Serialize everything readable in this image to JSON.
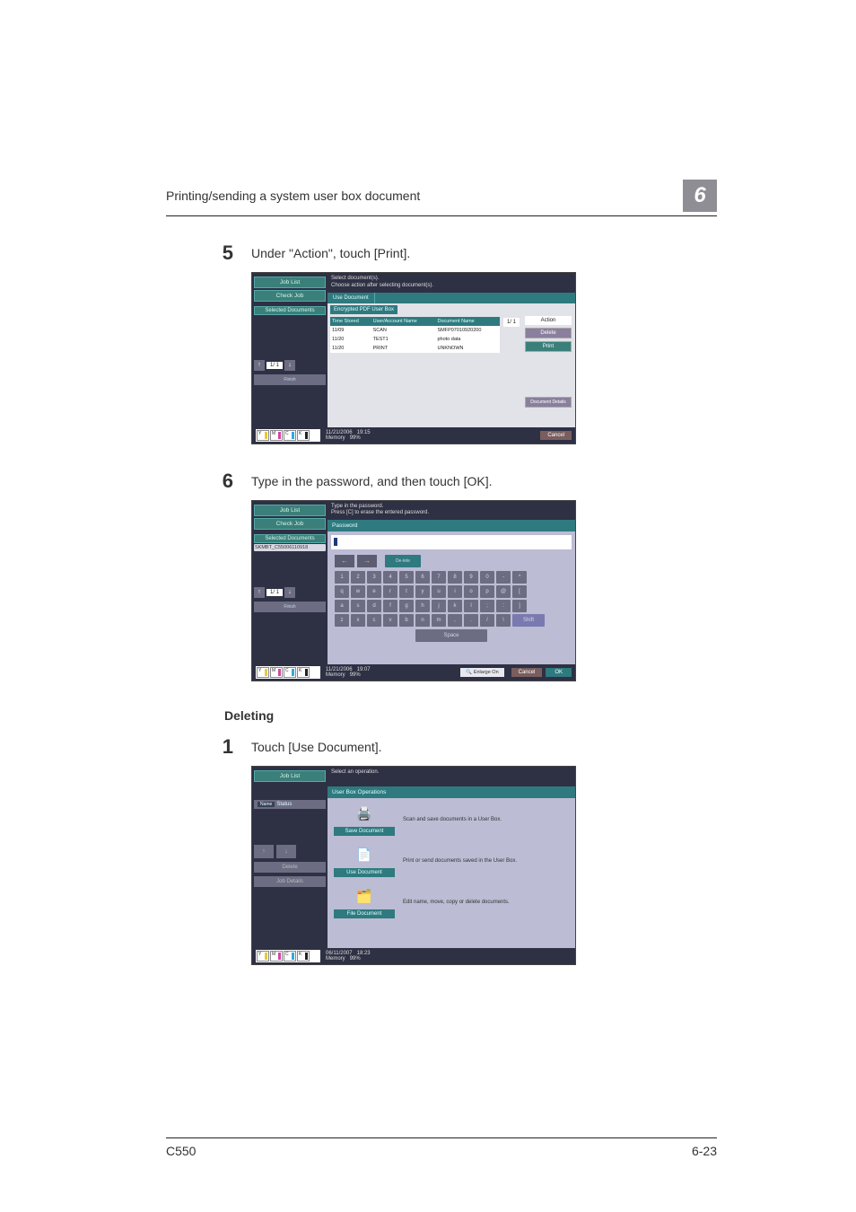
{
  "header": {
    "title": "Printing/sending a system user box document",
    "chapter": "6"
  },
  "steps": {
    "s5": {
      "num": "5",
      "text": "Under \"Action\", touch [Print]."
    },
    "s6": {
      "num": "6",
      "text": "Type in the password, and then touch [OK]."
    },
    "section": "Deleting",
    "s1": {
      "num": "1",
      "text": "Touch [Use Document]."
    }
  },
  "panelA": {
    "jobList": "Job List",
    "checkJob": "Check Job",
    "selDocs": "Selected Documents",
    "msg1": "Select document(s).",
    "msg2": "Choose action after selecting document(s).",
    "tab": "Use Document",
    "subtab": "Encrypted PDF User Box",
    "cols": {
      "time": "Time Stored",
      "user": "User/Account Name",
      "name": "Document Name"
    },
    "rows": [
      {
        "t": "11/09",
        "u": "SCAN",
        "n": "SMFP07010920200"
      },
      {
        "t": "11/20",
        "u": "TEST1",
        "n": "photo data"
      },
      {
        "t": "11/20",
        "u": "PRINT",
        "n": "UNKNOWN"
      }
    ],
    "pager": "1/  1",
    "action": "Action",
    "delete": "Delete",
    "print": "Print",
    "docDetails": "Document Details",
    "date": "11/21/2006",
    "time": "19:15",
    "mem": "Memory",
    "memv": "99%",
    "cancel": "Cancel",
    "finish": "Finish"
  },
  "panelB": {
    "jobList": "Job List",
    "checkJob": "Check Job",
    "selDocs": "Selected Documents",
    "docname": "SKMBT_C55006110918",
    "msg1": "Type in the password.",
    "msg2": "Press [C] to erase the entered password.",
    "title": "Password",
    "pager": "1/  1",
    "keys1": [
      "1",
      "2",
      "3",
      "4",
      "5",
      "6",
      "7",
      "8",
      "9",
      "0",
      "-",
      "^"
    ],
    "keys2": [
      "q",
      "w",
      "e",
      "r",
      "t",
      "y",
      "u",
      "i",
      "o",
      "p",
      "@",
      "["
    ],
    "keys3": [
      "a",
      "s",
      "d",
      "f",
      "g",
      "h",
      "j",
      "k",
      "l",
      ";",
      ":",
      "]"
    ],
    "keys4": [
      "z",
      "x",
      "c",
      "v",
      "b",
      "n",
      "m",
      ",",
      ".",
      "/",
      "\\"
    ],
    "delkey": "De-lete",
    "shift": "Shift",
    "space": "Space",
    "date": "11/21/2006",
    "time": "19:07",
    "mem": "Memory",
    "memv": "99%",
    "enlarge": "Enlarge On",
    "cancel": "Cancel",
    "ok": "OK",
    "finish": "Finish"
  },
  "panelC": {
    "jobList": "Job List",
    "msg": "Select an operation.",
    "tabtitle": "User Box Operations",
    "statusName": "Name",
    "statusStatus": "Status",
    "save": "Save Document",
    "saveDesc": "Scan and save documents in a User Box.",
    "use": "Use Document",
    "useDesc": "Print or send documents saved in the User Box.",
    "file": "File Document",
    "fileDesc": "Edit name, move, copy or delete documents.",
    "delete": "Delete",
    "details": "Job Details",
    "date": "06/11/2007",
    "time": "18:23",
    "mem": "Memory",
    "memv": "99%"
  },
  "footer": {
    "left": "C550",
    "right": "6-23"
  }
}
